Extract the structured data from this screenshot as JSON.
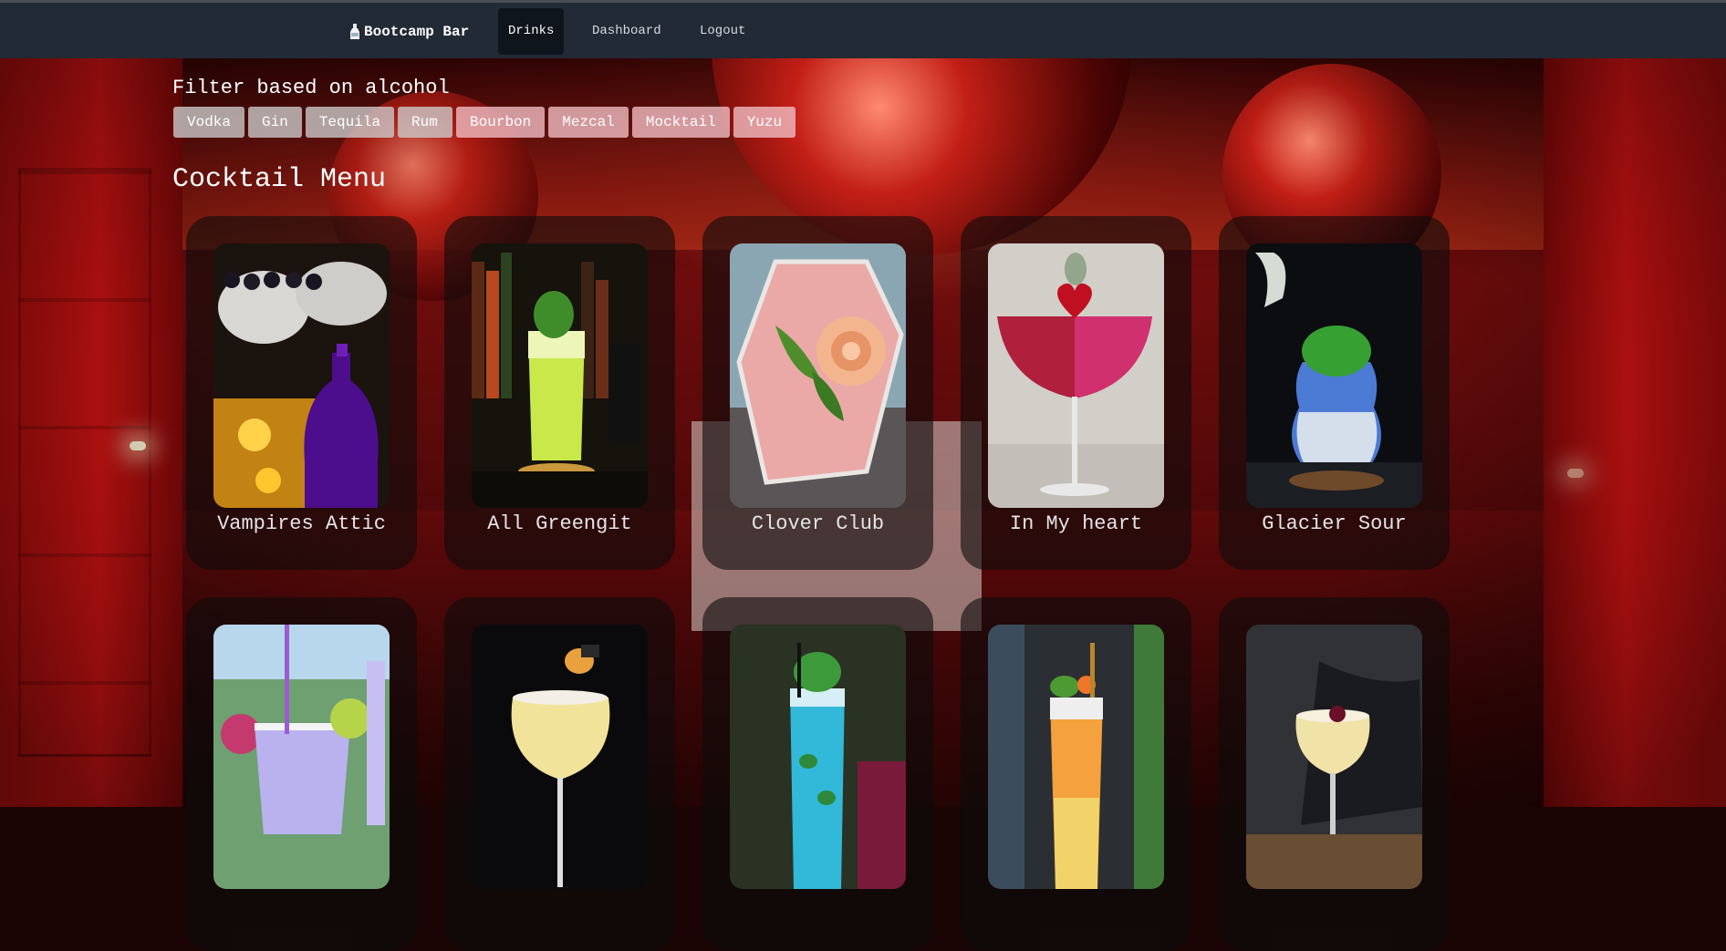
{
  "nav": {
    "brand": "Bootcamp Bar",
    "links": [
      {
        "label": "Drinks",
        "active": true
      },
      {
        "label": "Dashboard",
        "active": false
      },
      {
        "label": "Logout",
        "active": false
      }
    ]
  },
  "filter": {
    "title": "Filter based on alcohol",
    "options": [
      "Vodka",
      "Gin",
      "Tequila",
      "Rum",
      "Bourbon",
      "Mezcal",
      "Mocktail",
      "Yuzu"
    ]
  },
  "menu": {
    "title": "Cocktail Menu",
    "drinks": [
      {
        "name": "Vampires Attic",
        "image": "purple-smoke-drink-image"
      },
      {
        "name": "All Greengit",
        "image": "green-highball-image"
      },
      {
        "name": "Clover Club",
        "image": "pink-rose-drink-image"
      },
      {
        "name": "In My heart",
        "image": "red-coupe-heart-image"
      },
      {
        "name": "Glacier Sour",
        "image": "blue-glass-mint-image"
      },
      {
        "name": "",
        "image": "lavender-margarita-image"
      },
      {
        "name": "",
        "image": "yellow-coupe-image"
      },
      {
        "name": "",
        "image": "blue-mojito-image"
      },
      {
        "name": "",
        "image": "orange-layered-drink-image"
      },
      {
        "name": "",
        "image": "cream-sour-image"
      }
    ]
  },
  "colors": {
    "nav_bg": "#222a35",
    "nav_active": "#0f151d",
    "chip_grey": "#cdcdcd",
    "chip_pink": "#eeb8be"
  }
}
